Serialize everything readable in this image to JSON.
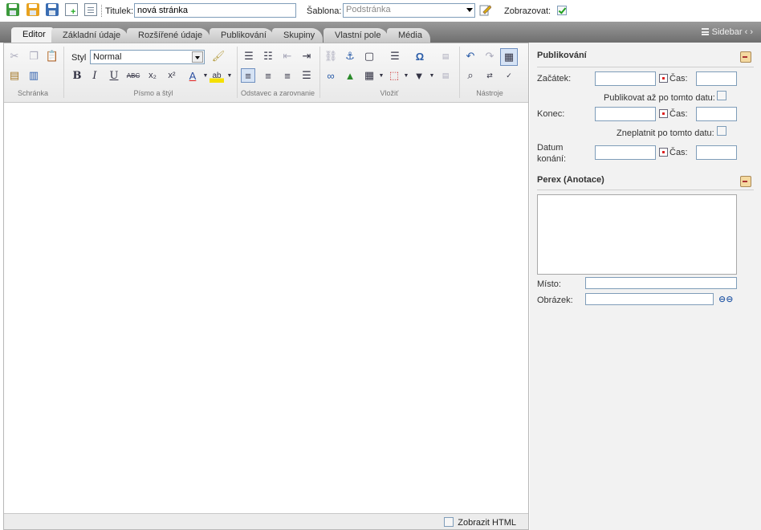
{
  "topbar": {
    "icons": [
      "save-icon",
      "save-as-icon",
      "save-close-icon",
      "new-page-icon",
      "document-icon"
    ],
    "title_label": "Titulek:",
    "title_value": "nová stránka",
    "template_label": "Šablona:",
    "template_value": "Podstránka",
    "visible_label": "Zobrazovat:",
    "visible_checked": true
  },
  "tabs": [
    "Editor",
    "Základní údaje",
    "Rozšířené údaje",
    "Publikování",
    "Skupiny",
    "Vlastní pole",
    "Média"
  ],
  "sidebar_toggle": "Sidebar ‹ ›",
  "toolbar": {
    "style_label": "Styl",
    "style_value": "Normal",
    "groups": [
      "Schránka",
      "Písmo a štýl",
      "Odstavec a zarovnanie",
      "Vložiť",
      "Nástroje"
    ]
  },
  "footer": {
    "show_html_label": "Zobrazit HTML"
  },
  "sidebar": {
    "publishing": {
      "heading": "Publikování",
      "start_label": "Začátek:",
      "time_label": "Čas:",
      "publish_after_label": "Publikovat až po tomto datu:",
      "end_label": "Konec:",
      "invalidate_after_label": "Zneplatnit po tomto datu:",
      "event_date_label_1": "Datum",
      "event_date_label_2": "konání:"
    },
    "perex": {
      "heading": "Perex (Anotace)",
      "place_label": "Místo:",
      "image_label": "Obrázek:"
    }
  },
  "colors": {
    "tabbar": "#7f7f7f",
    "sidebar_bg": "#f2f2f2",
    "save_green": "#3c9a3c",
    "save_orange": "#e8a21f",
    "save_blue": "#3a6db3"
  }
}
